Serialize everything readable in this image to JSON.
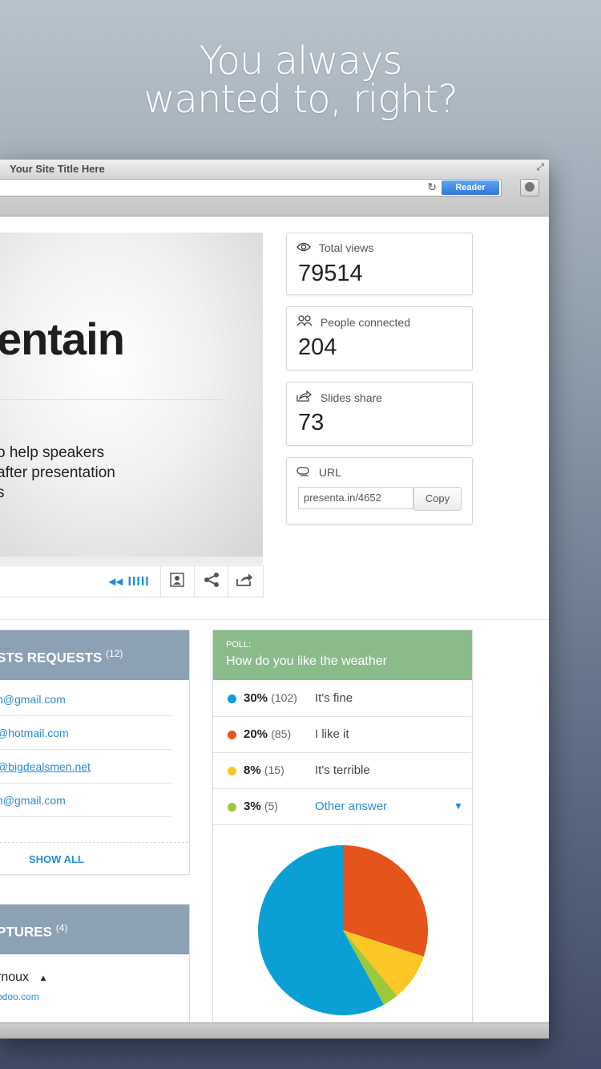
{
  "headline": {
    "line1": "You always",
    "line2": "wanted to, right?"
  },
  "browser": {
    "title": "Your Site Title Here",
    "reader_label": "Reader",
    "reload_icon": "reload-icon",
    "download_icon": "download-icon"
  },
  "slide": {
    "brand_text": "entain",
    "desc_line1": "o help speakers",
    "desc_line2": " after presentation",
    "desc_line3": "s",
    "controls": {
      "volume_glyph": "◂◂ IIIII",
      "icons": [
        "volume-icon",
        "person-icon",
        "share-icon",
        "export-icon"
      ]
    }
  },
  "stats": {
    "total_views": {
      "label": "Total views",
      "value": "79514",
      "icon": "eye-icon"
    },
    "people_connected": {
      "label": "People connected",
      "value": "204",
      "icon": "people-icon"
    },
    "slides_share": {
      "label": "Slides share",
      "value": "73",
      "icon": "share-box-icon"
    },
    "url": {
      "label": "URL",
      "value": "presenta.in/4652",
      "copy_label": "Copy",
      "icon": "link-icon"
    }
  },
  "requests": {
    "title": "STS REQUESTS",
    "count": "(12)",
    "items": [
      "n@gmail.com",
      "@hotmail.com",
      "@bigdealsmen.net",
      "n@gmail.com"
    ],
    "show_all": "SHOW ALL"
  },
  "captures": {
    "title": "PTURES",
    "count": "(4)",
    "name": "rnoux",
    "email": "odoo.com"
  },
  "poll": {
    "kicker": "POLL:",
    "question": "How do you like the weather",
    "colors": {
      "blue": "#0aa0d6",
      "orange": "#e5541a",
      "yellow": "#fdc627",
      "green": "#9cc93c"
    },
    "rows": [
      {
        "pct": "30%",
        "count": "(102)",
        "answer": "It's fine"
      },
      {
        "pct": "20%",
        "count": "(85)",
        "answer": "I like it"
      },
      {
        "pct": "8%",
        "count": "(15)",
        "answer": "It's terrible"
      },
      {
        "pct": "3%",
        "count": "(5)",
        "answer": "Other answer"
      }
    ]
  },
  "chart_data": {
    "type": "pie",
    "categories": [
      "It's fine",
      "I like it",
      "It's terrible",
      "Other answer"
    ],
    "values": [
      58,
      30,
      9,
      3
    ],
    "colors": [
      "#0aa0d6",
      "#e5541a",
      "#fdc627",
      "#9cc93c"
    ]
  }
}
